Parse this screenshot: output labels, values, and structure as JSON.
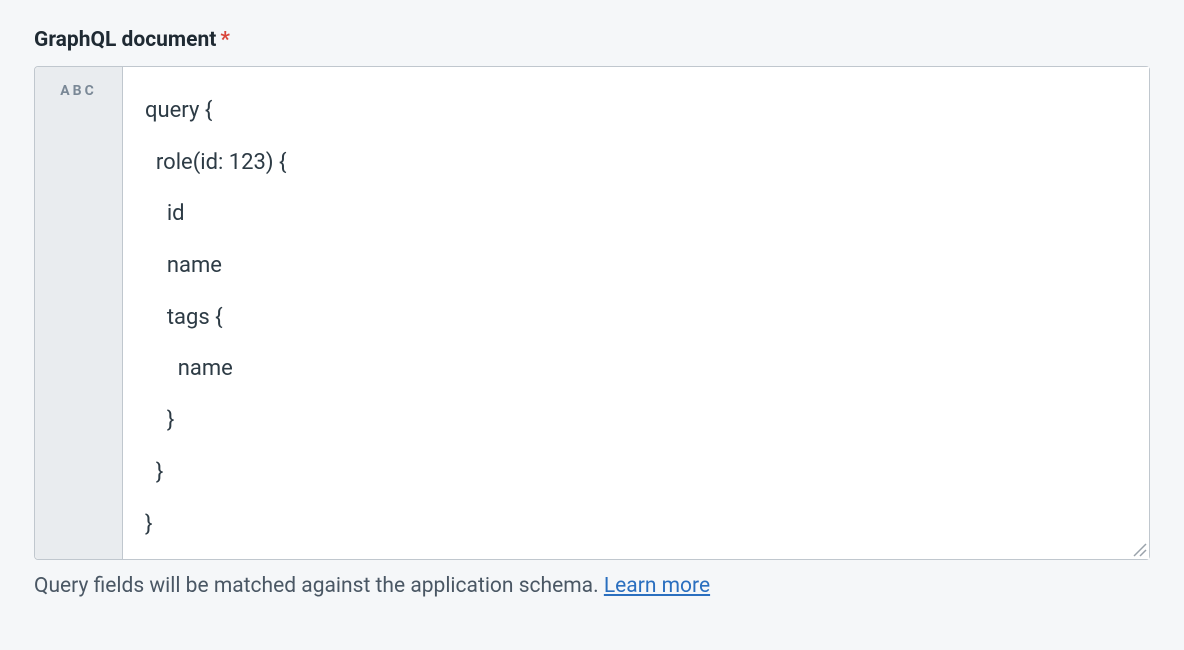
{
  "field": {
    "label": "GraphQL document",
    "required_marker": "*",
    "gutter_label": "ABC",
    "code": "query {\n  role(id: 123) {\n    id\n    name\n    tags {\n      name\n    }\n  }\n}"
  },
  "help": {
    "text": "Query fields will be matched against the application schema. ",
    "link_text": "Learn more"
  }
}
